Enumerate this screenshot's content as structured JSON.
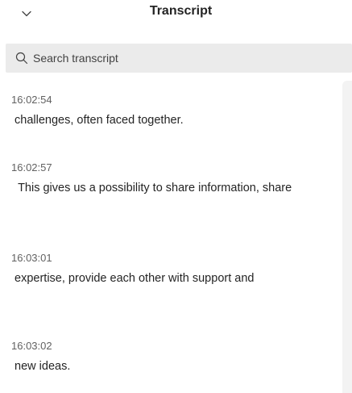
{
  "header": {
    "title": "Transcript",
    "collapse_icon": "chevron-down-icon"
  },
  "search": {
    "placeholder": "Search transcript",
    "value": "",
    "icon": "search-icon"
  },
  "entries": [
    {
      "time": "16:02:54",
      "text": " challenges, often faced together."
    },
    {
      "time": "16:02:57",
      "text": "  This gives us a possibility to share information, share"
    },
    {
      "time": "16:03:01",
      "text": " expertise, provide each other with support and"
    },
    {
      "time": "16:03:02",
      "text": " new ideas."
    }
  ]
}
